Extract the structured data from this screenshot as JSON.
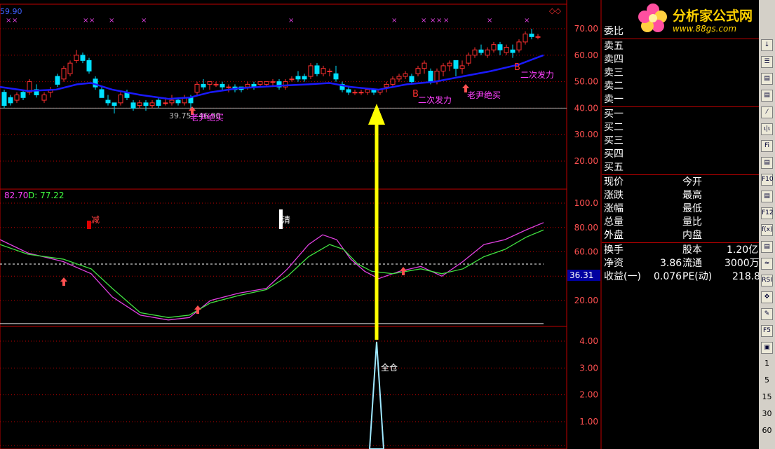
{
  "top_left_value": "59.90",
  "price_axis": [
    "70.00",
    "60.00",
    "50.00",
    "40.00",
    "30.00",
    "20.00"
  ],
  "kd_axis": [
    "100.0",
    "80.00",
    "60.00",
    "20.00"
  ],
  "bottom_axis": [
    "4.00",
    "3.00",
    "2.00",
    "1.00"
  ],
  "kd_header": {
    "k_value": "82.70",
    "d_label": "D: 77.22"
  },
  "kd_current_value": "36.31",
  "annotations": {
    "low_price": "39.75",
    "low_price2": "46.90",
    "buy_label_1": "老尹绝买",
    "buy_label_2": "老尹绝买",
    "second_burst_1": "二次发力",
    "second_burst_2": "二次发力",
    "b_marker": "B",
    "reduce_label": "减",
    "clear_label": "清",
    "full_position_label": "全仓"
  },
  "order_book": {
    "ratio_label": "委比",
    "sell": [
      "卖五",
      "卖四",
      "卖三",
      "卖二",
      "卖一"
    ],
    "buy": [
      "买一",
      "买二",
      "买三",
      "买四",
      "买五"
    ]
  },
  "quote_left": [
    "现价",
    "涨跌",
    "涨幅",
    "总量",
    "外盘"
  ],
  "quote_right": [
    "今开",
    "最高",
    "最低",
    "量比",
    "内盘"
  ],
  "fundamentals": [
    {
      "label": "换手",
      "value": "",
      "label2": "股本",
      "value2": "1.20亿"
    },
    {
      "label": "净资",
      "value": "3.86",
      "label2": "流通",
      "value2": "3000万"
    },
    {
      "label": "收益(一)",
      "value": "0.076",
      "label2": "PE(动)",
      "value2": "218.8"
    }
  ],
  "logo": {
    "title": "分析家公式网",
    "url": "www.88gs.com"
  },
  "toolbar_buttons": [
    "↓",
    "☰",
    "▤",
    "▤",
    "⁄",
    "ι|ι",
    "Fi",
    "▤",
    "F10",
    "▤",
    "F12",
    "f(x)",
    "▤",
    "≈",
    "RSI",
    "✥",
    "✎",
    "F5",
    "▣"
  ],
  "toolbar_periods": [
    "1",
    "5",
    "15",
    "30",
    "60"
  ],
  "colors": {
    "up": "#ff3030",
    "down": "#00e0ff",
    "ma": "#1a1aff",
    "k": "#e040e0",
    "d": "#40e040",
    "grid": "#c00000",
    "axis_text": "#ff5050",
    "arrow": "#ffff00"
  },
  "chart_data": {
    "type": "candlestick",
    "price_range": [
      15,
      75
    ],
    "kd_range": [
      0,
      110
    ],
    "bottom_range": [
      0,
      4.5
    ]
  }
}
